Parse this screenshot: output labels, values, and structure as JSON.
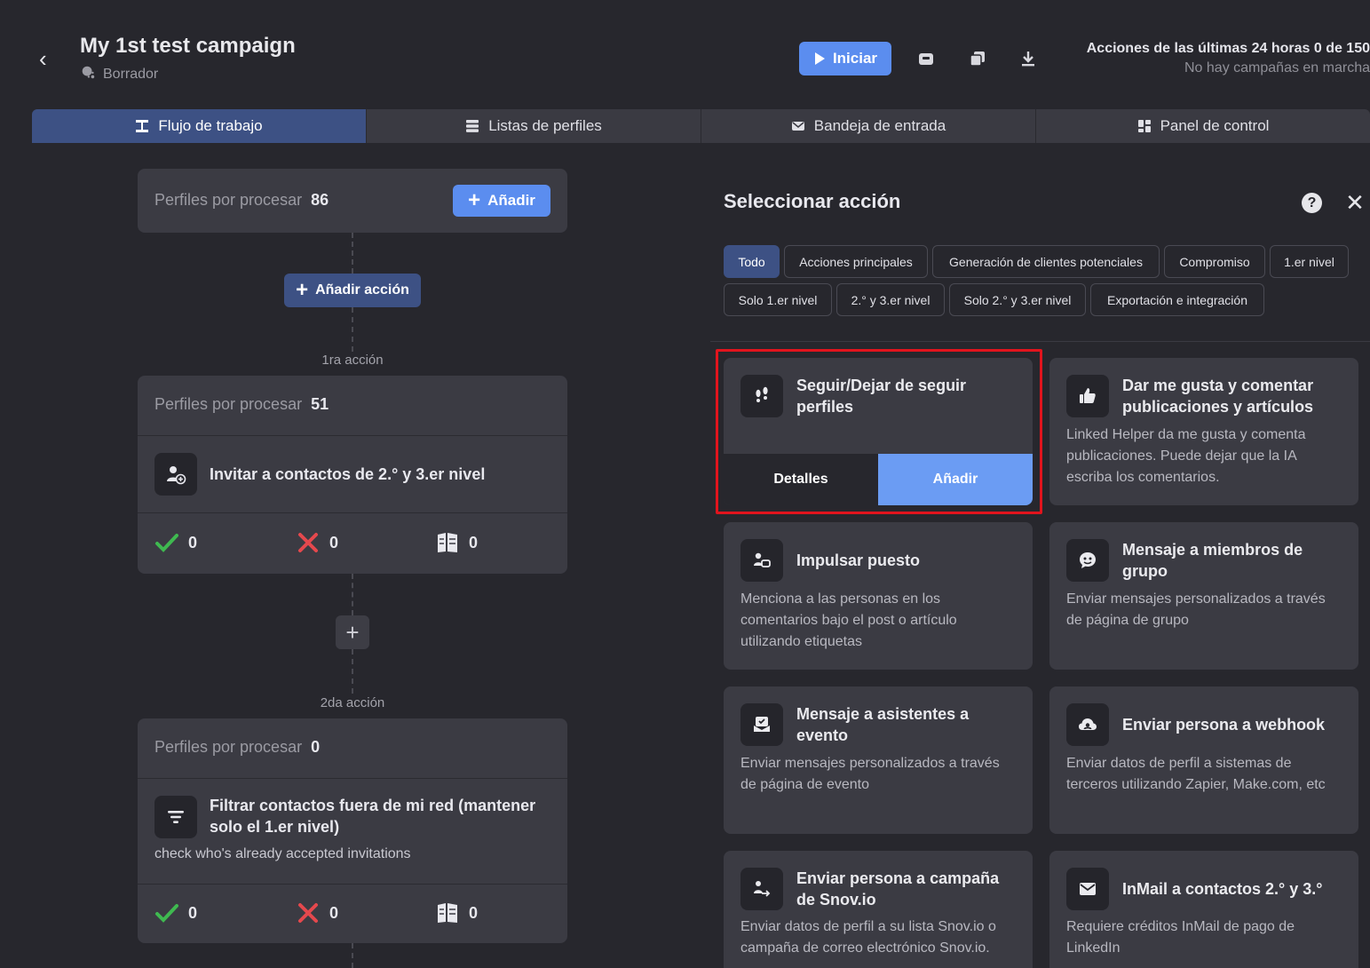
{
  "header": {
    "title": "My 1st test campaign",
    "status": "Borrador",
    "start_label": "Iniciar",
    "actions_title": "Acciones de las últimas 24 horas 0 de 150",
    "actions_sub": "No hay campañas en marcha"
  },
  "tabs": [
    {
      "label": "Flujo de trabajo",
      "icon": "workflow-icon",
      "active": true
    },
    {
      "label": "Listas de perfiles",
      "icon": "list-icon"
    },
    {
      "label": "Bandeja de entrada",
      "icon": "mail-icon"
    },
    {
      "label": "Panel de control",
      "icon": "dashboard-icon"
    }
  ],
  "workflow": {
    "top": {
      "label": "Perfiles por procesar",
      "count": "86",
      "add_label": "Añadir"
    },
    "add_action_label": "Añadir acción",
    "step1": {
      "step_label": "1ra acción",
      "label": "Perfiles por procesar",
      "count": "51",
      "action": "Invitar a contactos de 2.° y 3.er nivel",
      "success": "0",
      "fail": "0",
      "skipped": "0"
    },
    "step2": {
      "step_label": "2da acción",
      "label": "Perfiles por procesar",
      "count": "0",
      "action": "Filtrar contactos fuera de mi red (mantener solo el 1.er nivel)",
      "note": "check who's already accepted invitations",
      "success": "0",
      "fail": "0",
      "skipped": "0"
    }
  },
  "panel": {
    "title": "Seleccionar acción",
    "filters": [
      "Todo",
      "Acciones principales",
      "Generación de clientes potenciales",
      "Compromiso",
      "1.er nivel",
      "Solo 1.er nivel",
      "2.° y 3.er nivel",
      "Solo 2.° y 3.er nivel",
      "Exportación e integración"
    ],
    "active_filter": "Todo",
    "cards": [
      {
        "title": "Seguir/Dejar de seguir perfiles",
        "desc": "",
        "icon": "footprints-icon",
        "details_label": "Detalles",
        "add_label": "Añadir"
      },
      {
        "title": "Dar me gusta y comentar publicaciones y artículos",
        "desc": "Linked Helper da me gusta y comenta publicaciones. Puede dejar que la IA escriba los comentarios.",
        "icon": "thumbs-up-icon"
      },
      {
        "title": "Impulsar puesto",
        "desc": "Menciona a las personas en los comentarios bajo el post o artículo utilizando etiquetas",
        "icon": "boost-icon"
      },
      {
        "title": "Mensaje a miembros de grupo",
        "desc": "Enviar mensajes personalizados a través de página de grupo",
        "icon": "group-chat-icon"
      },
      {
        "title": "Mensaje a asistentes a evento",
        "desc": "Enviar mensajes personalizados a través de página de evento",
        "icon": "event-message-icon"
      },
      {
        "title": "Enviar persona a webhook",
        "desc": "Enviar datos de perfil a sistemas de terceros utilizando Zapier, Make.com, etc",
        "icon": "webhook-icon"
      },
      {
        "title": "Enviar persona a campaña de Snov.io",
        "desc": "Enviar datos de perfil a su lista Snov.io o campaña de correo electrónico Snov.io.",
        "icon": "person-send-icon"
      },
      {
        "title": "InMail a contactos 2.° y 3.°",
        "desc": "Requiere créditos InMail de pago de LinkedIn",
        "icon": "envelope-icon"
      }
    ]
  },
  "colors": {
    "background": "#27272d",
    "card": "#3b3b43",
    "accent": "#5b8def",
    "active_tab": "#3d5184",
    "success": "#3fb950",
    "danger": "#e5484d",
    "highlight": "#e1141d"
  }
}
